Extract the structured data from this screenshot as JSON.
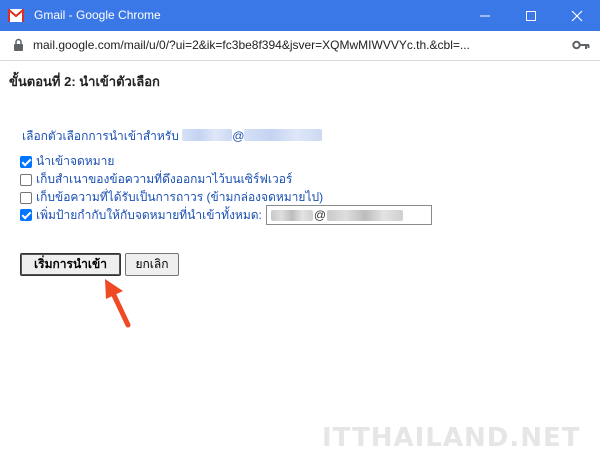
{
  "window": {
    "title": "Gmail - Google Chrome"
  },
  "browser": {
    "url": "mail.google.com/mail/u/0/?ui=2&ik=fc3be8f394&jsver=XQMwMIWVVYc.th.&cbl=..."
  },
  "dialog": {
    "step_title": "ขั้นตอนที่ 2: นำเข้าตัวเลือก",
    "select_label": "เลือกตัวเลือกการนำเข้าสำหรับ",
    "at_symbol": "@",
    "options": [
      {
        "label": "นำเข้าจดหมาย",
        "checked": true
      },
      {
        "label": "เก็บสำเนาของข้อความที่ดึงออกมาไว้บนเซิร์ฟเวอร์",
        "checked": false
      },
      {
        "label": "เก็บข้อความที่ได้รับเป็นการถาวร (ข้ามกล่องจดหมายไป)",
        "checked": false
      },
      {
        "label": "เพิ่มป้ายกำกับให้กับจดหมายที่นำเข้าทั้งหมด:",
        "checked": true
      }
    ],
    "label_input_at": "@",
    "start_button": "เริ่มการนำเข้า",
    "cancel_button": "ยกเลิก"
  },
  "watermark": "ITTHAILAND.NET",
  "colors": {
    "titlebar": "#3b78e7",
    "link_text": "#1a4fb4",
    "arrow": "#f04a24"
  }
}
